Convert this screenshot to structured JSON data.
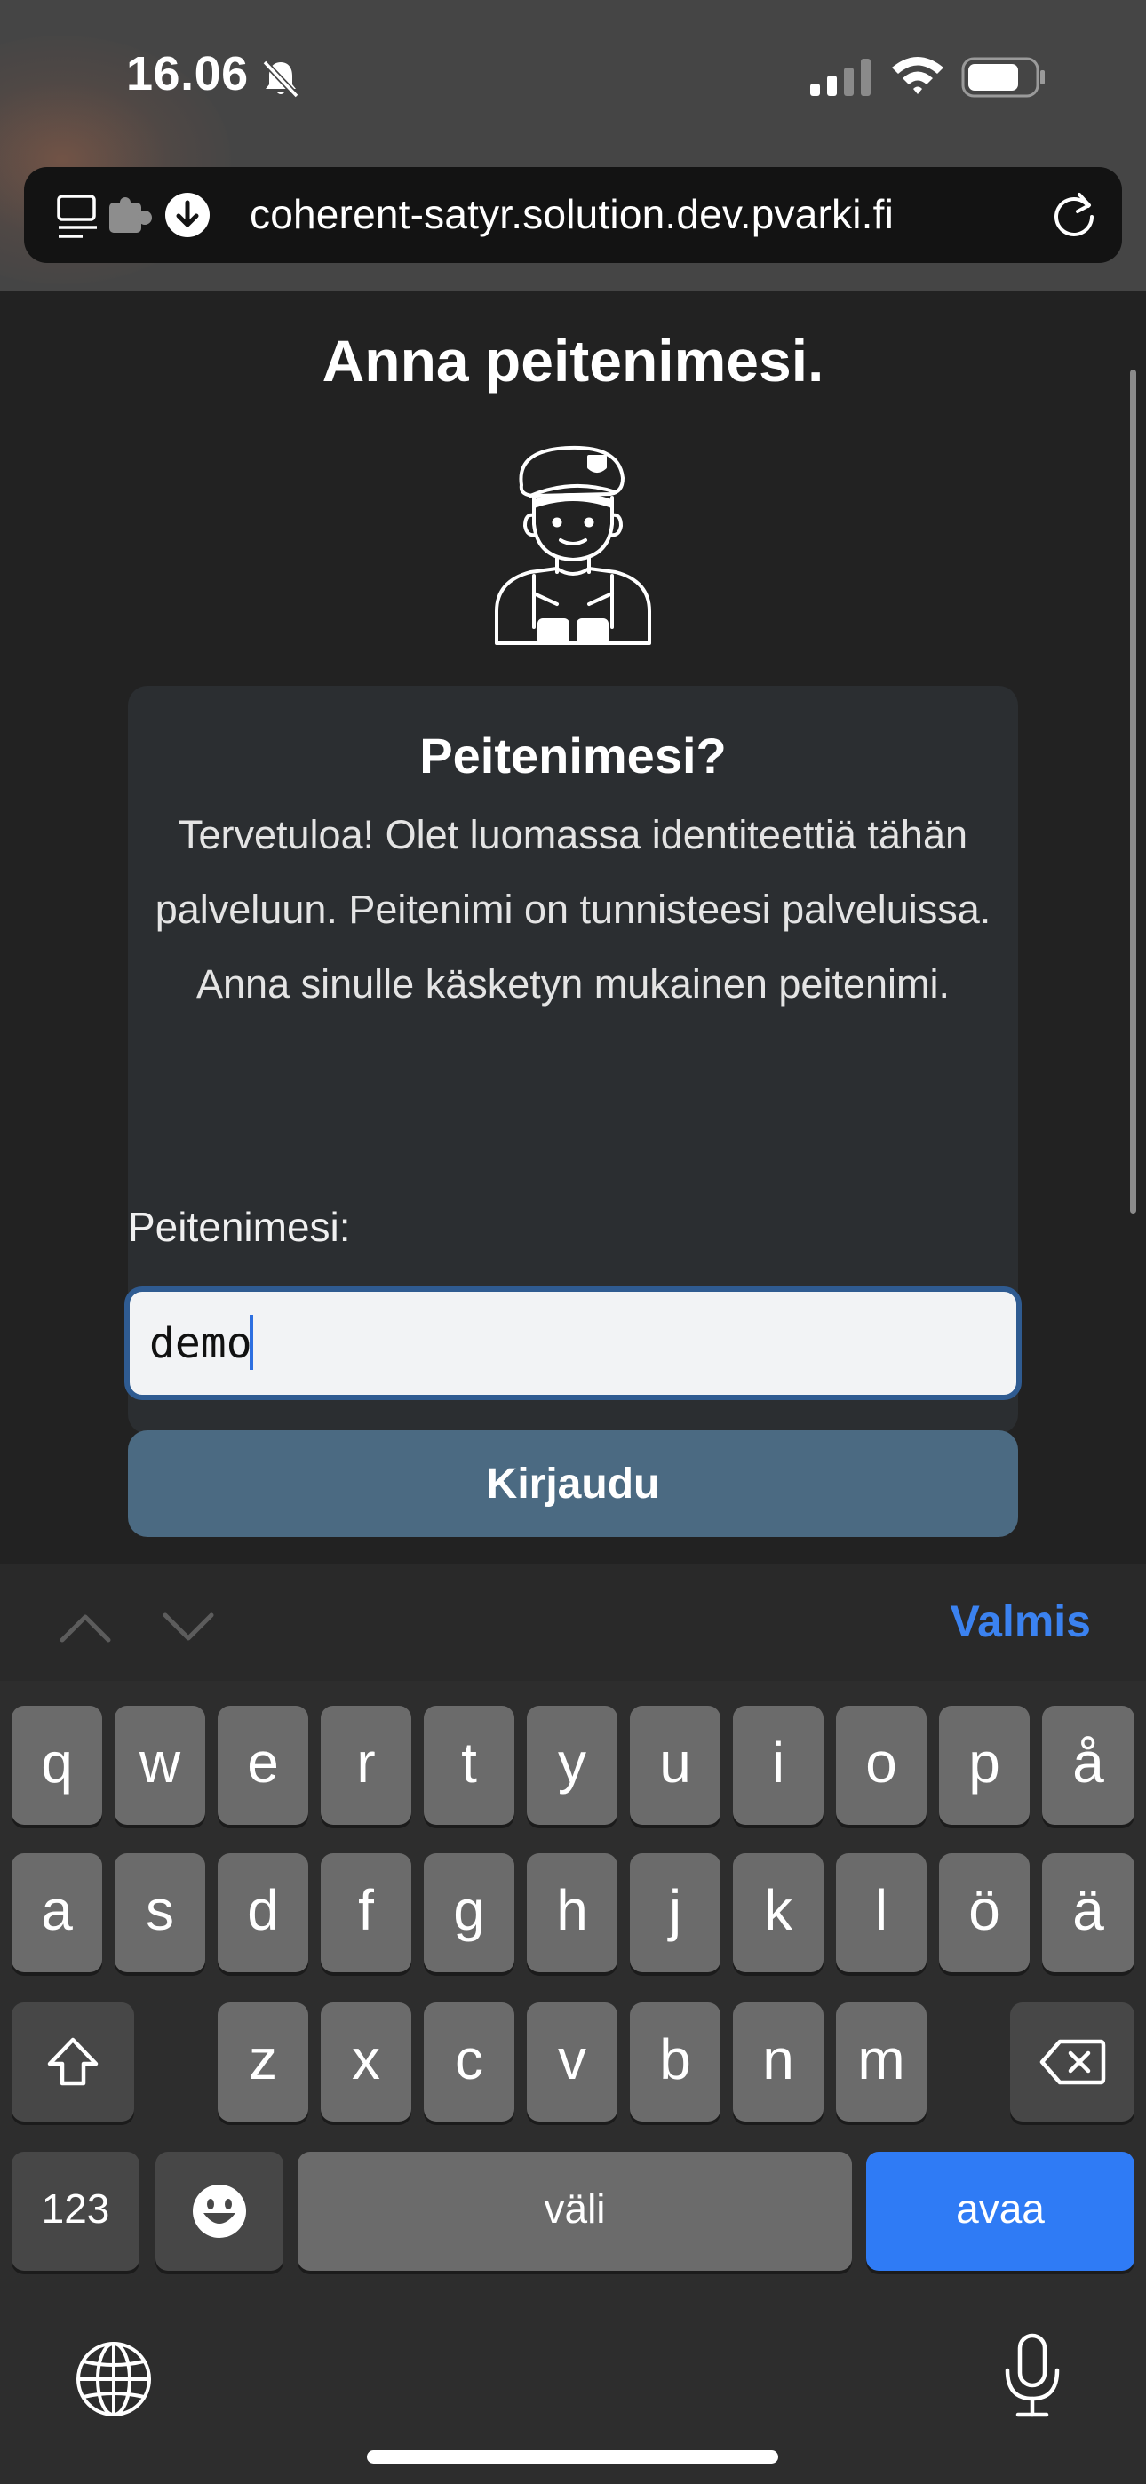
{
  "status_bar": {
    "time": "16.06"
  },
  "browser": {
    "url": "coherent-satyr.solution.dev.pvarki.fi"
  },
  "page": {
    "title": "Anna peitenimesi.",
    "card": {
      "title": "Peitenimesi?",
      "text": "Tervetuloa! Olet luomassa identiteettiä tähän palveluun. Peitenimi on tunnisteesi palveluissa. Anna sinulle käsketyn mukainen peitenimi."
    },
    "input_label": "Peitenimesi:",
    "input_value": "demo",
    "login_button": "Kirjaudu"
  },
  "keyboard": {
    "done_label": "Valmis",
    "rows": [
      [
        "q",
        "w",
        "e",
        "r",
        "t",
        "y",
        "u",
        "i",
        "o",
        "p",
        "å"
      ],
      [
        "a",
        "s",
        "d",
        "f",
        "g",
        "h",
        "j",
        "k",
        "l",
        "ö",
        "ä"
      ],
      [
        "z",
        "x",
        "c",
        "v",
        "b",
        "n",
        "m"
      ]
    ],
    "numbers_label": "123",
    "space_label": "väli",
    "return_label": "avaa"
  },
  "colors": {
    "accent": "#3b82f0",
    "button": "#4b6a82",
    "input_border": "#2f5b91",
    "return_key": "#2f7bf5"
  }
}
